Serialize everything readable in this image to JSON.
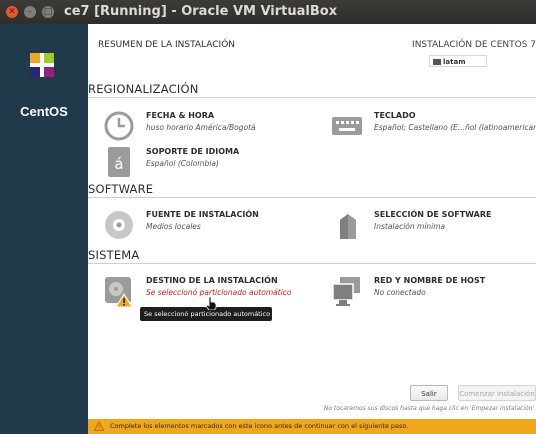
{
  "window": {
    "title": "ce7 [Running] - Oracle VM VirtualBox",
    "buttons": {
      "close_glyph": "✕",
      "minimize_glyph": "–",
      "maximize_glyph": "□"
    }
  },
  "sidebar": {
    "brand": "CentOS"
  },
  "header": {
    "title": "RESUMEN DE LA INSTALACIÓN",
    "product": "INSTALACIÓN DE CENTOS 7",
    "keyboard": "latam"
  },
  "sections": {
    "regionalizacion": {
      "title": "REGIONALIZACIÓN",
      "spokes": [
        {
          "title": "FECHA & HORA",
          "status": "huso horario América/Bogotá",
          "icon": "clock-icon"
        },
        {
          "title": "TECLADO",
          "status": "Español; Castellano (E...ñol (latinoamericano))",
          "icon": "keyboard-icon"
        },
        {
          "title": "SOPORTE DE IDIOMA",
          "status": "Español (Colombia)",
          "icon": "language-icon"
        }
      ]
    },
    "software": {
      "title": "SOFTWARE",
      "spokes": [
        {
          "title": "FUENTE DE INSTALACIÓN",
          "status": "Medios locales",
          "icon": "disc-icon"
        },
        {
          "title": "SELECCIÓN DE SOFTWARE",
          "status": "Instalación mínima",
          "icon": "package-icon"
        }
      ]
    },
    "sistema": {
      "title": "SISTEMA",
      "spokes": [
        {
          "title": "DESTINO DE LA INSTALACIÓN",
          "status": "Se seleccionó particionado automático",
          "icon": "hard-drive-icon"
        },
        {
          "title": "RED Y NOMBRE DE HOST",
          "status": "No conectado",
          "icon": "network-icon"
        }
      ]
    }
  },
  "tooltip": "Se seleccionó particionado automático",
  "footer": {
    "quit": "Salir",
    "begin": "Comenzar instalación",
    "note": "No tocaremos sus discos hasta que haga clic en 'Empezar instalación'."
  },
  "warning_bar": {
    "message": "Complete los elementos marcados con este icono antes de continuar con el siguiente paso."
  },
  "colors": {
    "sidebar": "#203a4c",
    "warning": "#f0a71c",
    "warning_text": "#cc1f16",
    "titlebar": "#3c3b37"
  }
}
